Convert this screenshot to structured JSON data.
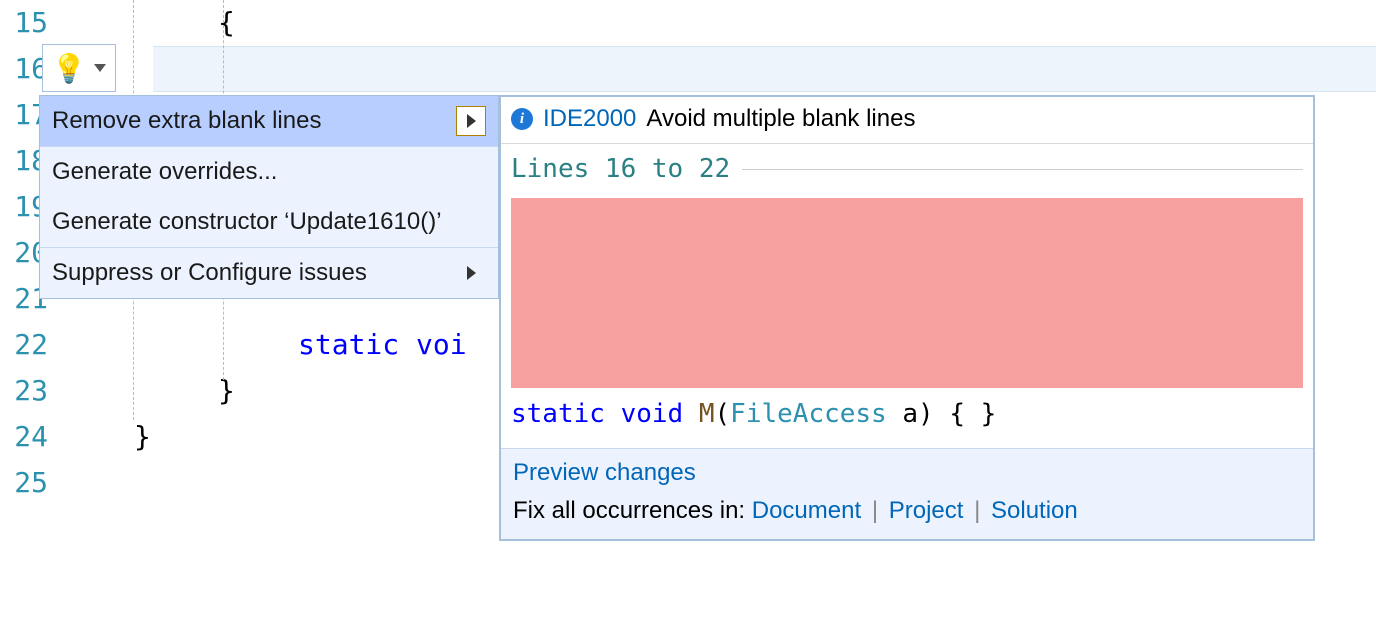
{
  "gutter": {
    "start": 15,
    "end": 25
  },
  "code": {
    "line15": "{",
    "line22_kw": "static voi",
    "line23": "}",
    "line24": "}"
  },
  "quickfix": {
    "items": [
      {
        "label": "Remove extra blank lines",
        "has_submenu": true,
        "selected": true
      },
      {
        "label": "Generate overrides...",
        "has_submenu": false
      },
      {
        "label": "Generate constructor ‘Update1610()’",
        "has_submenu": false
      },
      {
        "label": "Suppress or Configure issues",
        "has_submenu": true
      }
    ]
  },
  "preview": {
    "rule_id": "IDE2000",
    "rule_text": "Avoid multiple blank lines",
    "range_label": "Lines 16 to 22",
    "codeline": {
      "kw1": "static",
      "kw2": "void",
      "method": "M",
      "paren_open": "(",
      "type": "FileAccess",
      "param": " a",
      "rest": ") { }"
    },
    "footer": {
      "preview_changes": "Preview changes",
      "fix_label": "Fix all occurrences in: ",
      "scope_document": "Document",
      "scope_project": "Project",
      "scope_solution": "Solution",
      "sep": "|"
    }
  }
}
